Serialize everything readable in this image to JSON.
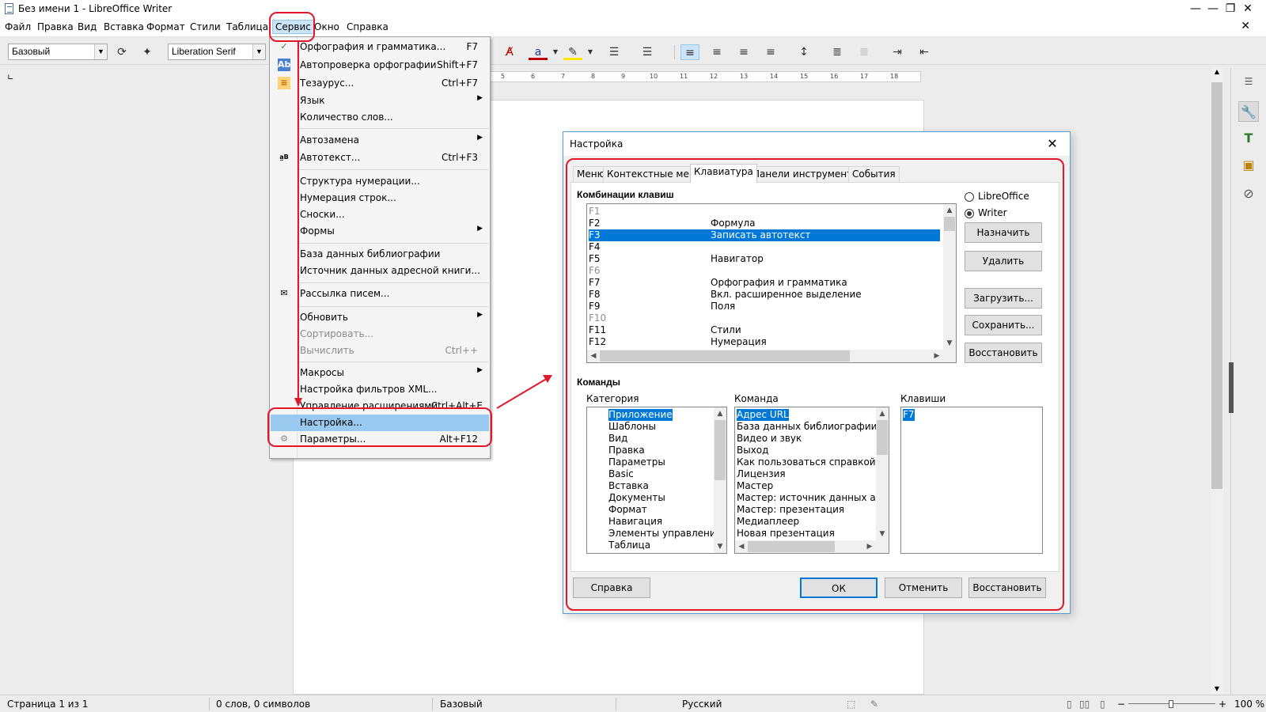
{
  "window": {
    "title": "Без имени 1 - LibreOffice Writer",
    "min": "—",
    "max": "❐",
    "close": "✕"
  },
  "menubar": {
    "items": [
      "Файл",
      "Правка",
      "Вид",
      "Вставка",
      "Формат",
      "Стили",
      "Таблица",
      "Сервис",
      "Окно",
      "Справка"
    ],
    "close": "✕"
  },
  "toolbar": {
    "style": "Базовый",
    "font": "Liberation Serif"
  },
  "ruler": {
    "ticks": [
      "5",
      "6",
      "7",
      "8",
      "9",
      "10",
      "11",
      "12",
      "13",
      "14",
      "15",
      "16",
      "17",
      "18"
    ]
  },
  "tools_menu": {
    "items": [
      {
        "label": "Орфография и грамматика...",
        "key": "F7"
      },
      {
        "label": "Автопроверка орфографии",
        "key": "Shift+F7"
      },
      {
        "label": "Тезаурус...",
        "key": "Ctrl+F7"
      },
      {
        "label": "Язык",
        "key": ""
      },
      {
        "label": "Количество слов...",
        "key": ""
      },
      {
        "label": "Автозамена",
        "key": ""
      },
      {
        "label": "Автотекст...",
        "key": "Ctrl+F3"
      },
      {
        "label": "Структура нумерации...",
        "key": ""
      },
      {
        "label": "Нумерация строк...",
        "key": ""
      },
      {
        "label": "Сноски...",
        "key": ""
      },
      {
        "label": "Формы",
        "key": ""
      },
      {
        "label": "База данных библиографии",
        "key": ""
      },
      {
        "label": "Источник данных адресной книги...",
        "key": ""
      },
      {
        "label": "Рассылка писем...",
        "key": ""
      },
      {
        "label": "Обновить",
        "key": ""
      },
      {
        "label": "Сортировать...",
        "key": ""
      },
      {
        "label": "Вычислить",
        "key": "Ctrl++"
      },
      {
        "label": "Макросы",
        "key": ""
      },
      {
        "label": "Настройка фильтров XML...",
        "key": ""
      },
      {
        "label": "Управление расширениями...",
        "key": "Ctrl+Alt+E"
      },
      {
        "label": "Настройка...",
        "key": ""
      },
      {
        "label": "Параметры...",
        "key": "Alt+F12"
      }
    ]
  },
  "dialog": {
    "title": "Настройка",
    "tabs": [
      "Меню",
      "Контекстные меню",
      "Клавиатура",
      "Панели инструментов",
      "События"
    ],
    "shortcuts_label": "Комбинации клавиш",
    "shortcuts": [
      {
        "key": "F1",
        "cmd": ""
      },
      {
        "key": "F2",
        "cmd": "Формула"
      },
      {
        "key": "F3",
        "cmd": "Записать автотекст"
      },
      {
        "key": "F4",
        "cmd": ""
      },
      {
        "key": "F5",
        "cmd": "Навигатор"
      },
      {
        "key": "F6",
        "cmd": ""
      },
      {
        "key": "F7",
        "cmd": "Орфография и грамматика"
      },
      {
        "key": "F8",
        "cmd": "Вкл. расширенное выделение"
      },
      {
        "key": "F9",
        "cmd": "Поля"
      },
      {
        "key": "F10",
        "cmd": ""
      },
      {
        "key": "F11",
        "cmd": "Стили"
      },
      {
        "key": "F12",
        "cmd": "Нумерация"
      }
    ],
    "radio_lo": "LibreOffice",
    "radio_writer": "Writer",
    "btn_assign": "Назначить",
    "btn_delete": "Удалить",
    "btn_load": "Загрузить...",
    "btn_save": "Сохранить...",
    "btn_reset": "Восстановить",
    "commands_label": "Команды",
    "category_label": "Категория",
    "command_label": "Команда",
    "keys_label": "Клавиши",
    "categories": [
      "Приложение",
      "Шаблоны",
      "Вид",
      "Правка",
      "Параметры",
      "Basic",
      "Вставка",
      "Документы",
      "Формат",
      "Навигация",
      "Элементы управления",
      "Таблица"
    ],
    "commands": [
      "Адрес URL",
      "База данных библиографии",
      "Видео и звук",
      "Выход",
      "Как пользоваться справкой",
      "Лицензия",
      "Мастер",
      "Мастер: источник данных адрес",
      "Мастер: презентация",
      "Медиаплеер",
      "Новая презентация"
    ],
    "keys": [
      "F7"
    ],
    "btn_help": "Справка",
    "btn_ok": "ОК",
    "btn_cancel": "Отменить",
    "btn_restore": "Восстановить"
  },
  "statusbar": {
    "page": "Страница 1 из 1",
    "words": "0 слов, 0 символов",
    "style": "Базовый",
    "lang": "Русский",
    "zoom": "100 %"
  },
  "colors": {
    "accent": "#0078d7",
    "annotation": "#e0182a"
  }
}
